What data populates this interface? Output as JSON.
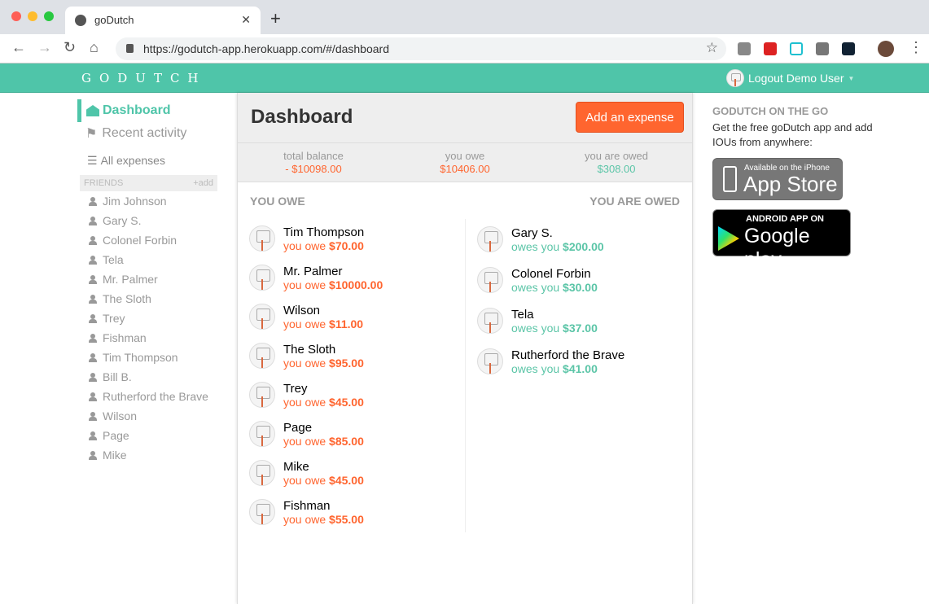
{
  "browser": {
    "tab_title": "goDutch",
    "url": "https://godutch-app.herokuapp.com/#/dashboard"
  },
  "header": {
    "logo": "GODUTCH",
    "user_menu": "Logout Demo User"
  },
  "sidebar": {
    "dashboard": "Dashboard",
    "recent": "Recent activity",
    "all": "All expenses",
    "friends_title": "FRIENDS",
    "add": "add",
    "friends": [
      "Jim Johnson",
      "Gary S.",
      "Colonel Forbin",
      "Tela",
      "Mr. Palmer",
      "The Sloth",
      "Trey",
      "Fishman",
      "Tim Thompson",
      "Bill B.",
      "Rutherford the Brave",
      "Wilson",
      "Page",
      "Mike"
    ]
  },
  "main": {
    "title": "Dashboard",
    "add_button": "Add an expense",
    "balances": [
      {
        "label": "total balance",
        "value": "- $10098.00"
      },
      {
        "label": "you owe",
        "value": "$10406.00"
      },
      {
        "label": "you are owed",
        "value": "$308.00"
      }
    ],
    "you_owe_title": "YOU OWE",
    "owed_title": "YOU ARE OWED",
    "you_owe": [
      {
        "name": "Tim Thompson",
        "prefix": "you owe",
        "amount": "$70.00"
      },
      {
        "name": "Mr. Palmer",
        "prefix": "you owe",
        "amount": "$10000.00"
      },
      {
        "name": "Wilson",
        "prefix": "you owe",
        "amount": "$11.00"
      },
      {
        "name": "The Sloth",
        "prefix": "you owe",
        "amount": "$95.00"
      },
      {
        "name": "Trey",
        "prefix": "you owe",
        "amount": "$45.00"
      },
      {
        "name": "Page",
        "prefix": "you owe",
        "amount": "$85.00"
      },
      {
        "name": "Mike",
        "prefix": "you owe",
        "amount": "$45.00"
      },
      {
        "name": "Fishman",
        "prefix": "you owe",
        "amount": "$55.00"
      }
    ],
    "owed": [
      {
        "name": "Gary S.",
        "prefix": "owes you",
        "amount": "$200.00"
      },
      {
        "name": "Colonel Forbin",
        "prefix": "owes you",
        "amount": "$30.00"
      },
      {
        "name": "Tela",
        "prefix": "owes you",
        "amount": "$37.00"
      },
      {
        "name": "Rutherford the Brave",
        "prefix": "owes you",
        "amount": "$41.00"
      }
    ]
  },
  "right": {
    "title": "GODUTCH ON THE GO",
    "text": "Get the free goDutch app and add IOUs from anywhere:",
    "appstore_small": "Available on the iPhone",
    "appstore_big": "App Store",
    "gplay_small": "ANDROID APP ON",
    "gplay_big": "Google play"
  },
  "colors": {
    "brand": "#4fc5a9",
    "orange": "#ff652f",
    "green": "#5bc5a7"
  }
}
